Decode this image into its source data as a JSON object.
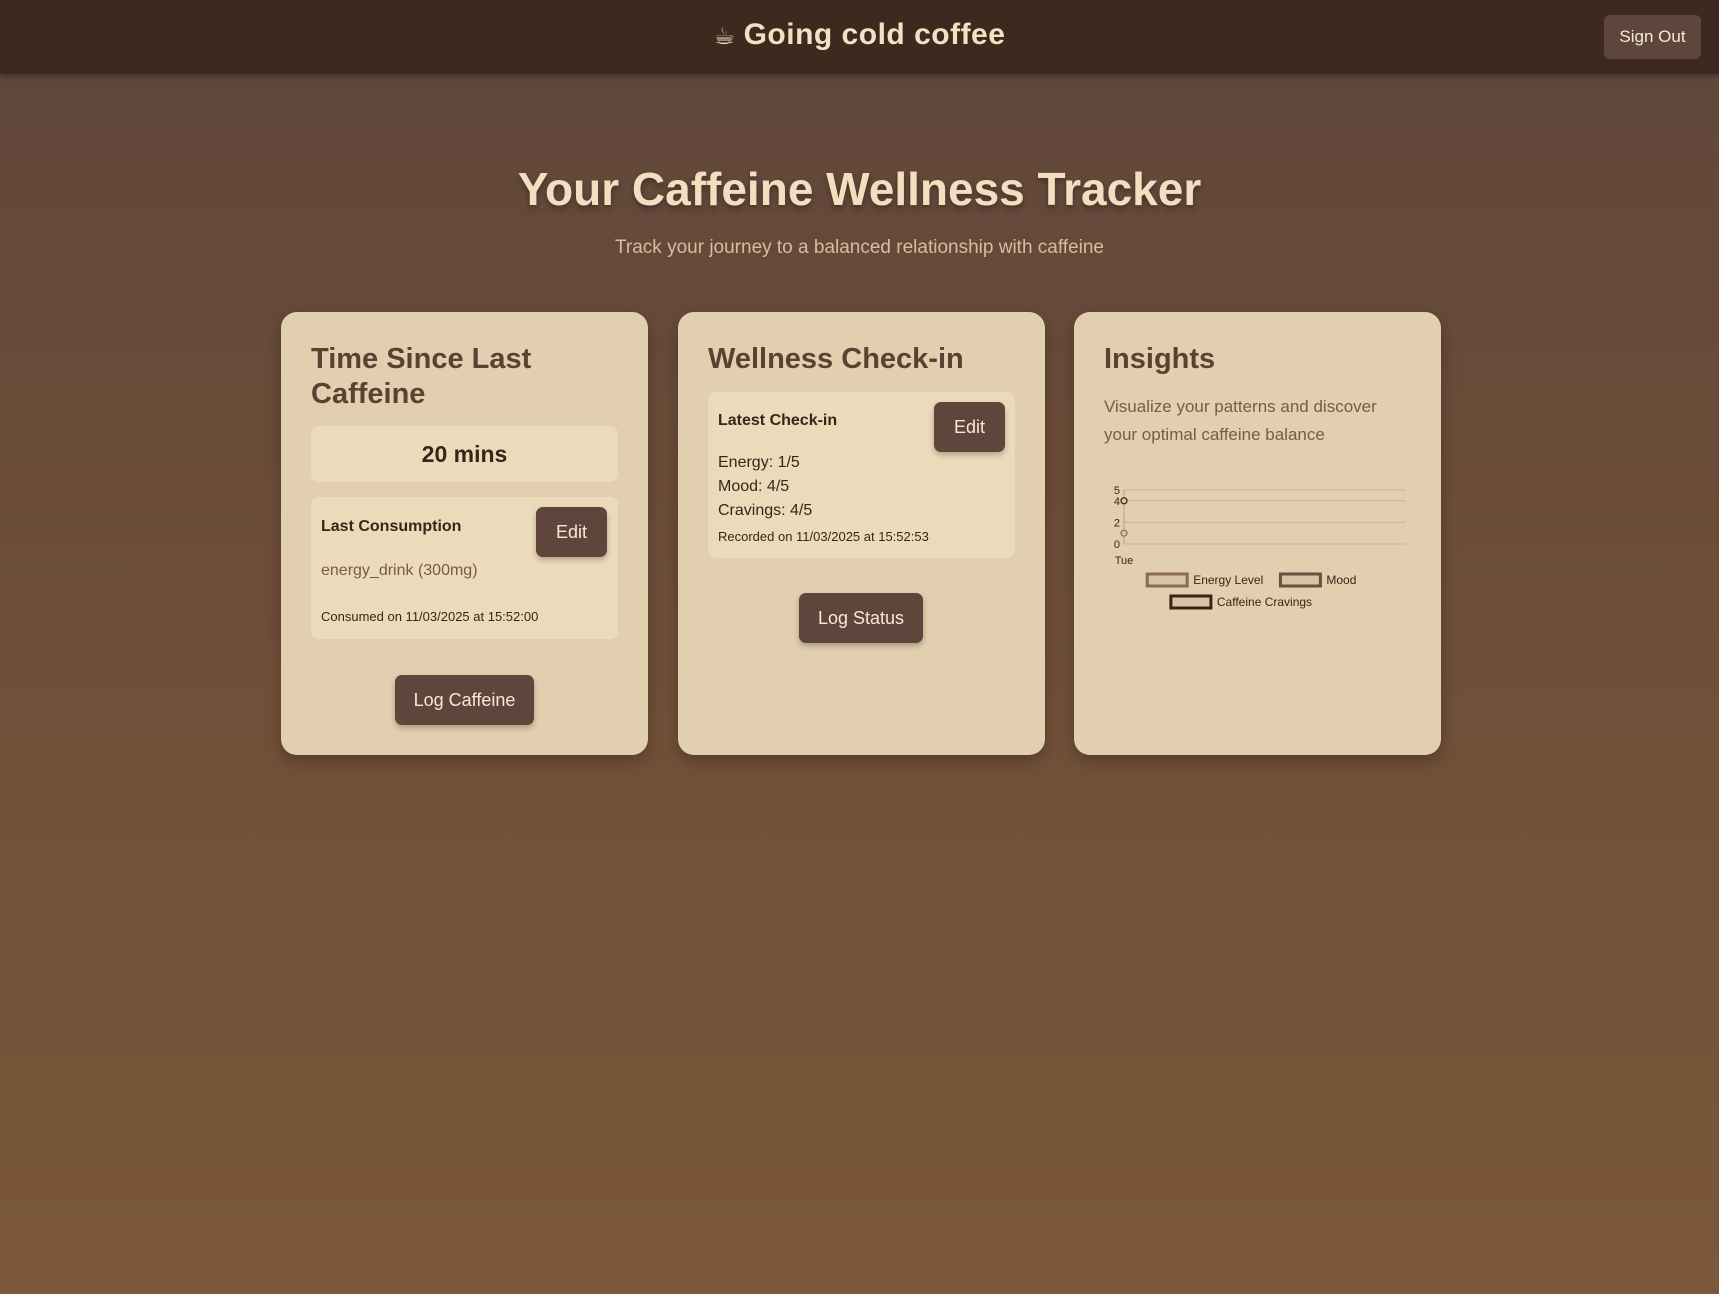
{
  "header": {
    "icon": "coffee-cup-icon",
    "title": "Going cold coffee",
    "sign_out": "Sign Out"
  },
  "hero": {
    "title": "Your Caffeine Wellness Tracker",
    "subtitle": "Track your journey to a balanced relationship with caffeine"
  },
  "time_card": {
    "title": "Time Since Last Caffeine",
    "elapsed": "20 mins",
    "last_label": "Last Consumption",
    "edit": "Edit",
    "drink": "energy_drink (300mg)",
    "consumed_on": "Consumed on 11/03/2025 at 15:52:00",
    "log_button": "Log Caffeine"
  },
  "wellness_card": {
    "title": "Wellness Check-in",
    "latest_label": "Latest Check-in",
    "edit": "Edit",
    "energy": "Energy: 1/5",
    "mood": "Mood: 4/5",
    "cravings": "Cravings: 4/5",
    "recorded_on": "Recorded on 11/03/2025 at 15:52:53",
    "log_button": "Log Status"
  },
  "insights_card": {
    "title": "Insights",
    "description": "Visualize your patterns and discover your optimal caffeine balance"
  },
  "chart_data": {
    "type": "line",
    "x": [
      "Tue"
    ],
    "y_ticks": [
      0,
      2,
      4,
      5
    ],
    "ylim": [
      0,
      5
    ],
    "grid": true,
    "legend": "bottom",
    "series": [
      {
        "name": "Energy Level",
        "values": [
          1
        ],
        "color": "#8a6a55"
      },
      {
        "name": "Mood",
        "values": [
          4
        ],
        "color": "#6b5040"
      },
      {
        "name": "Caffeine Cravings",
        "values": [
          4
        ],
        "color": "#3a2418"
      }
    ]
  }
}
